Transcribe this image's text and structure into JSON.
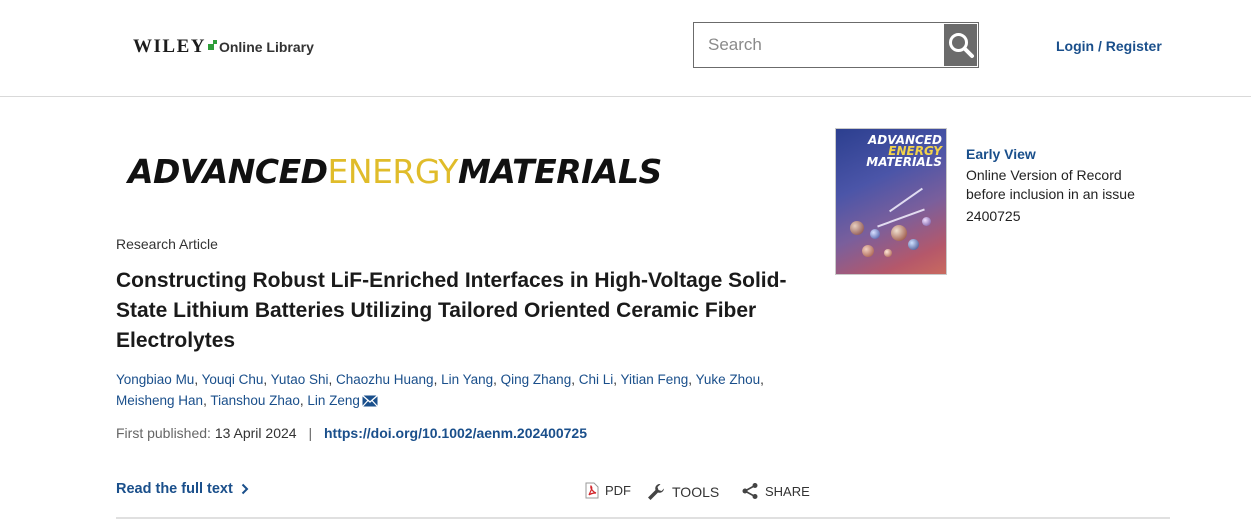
{
  "header": {
    "logo_wiley": "WILEY",
    "logo_online_library": "Online Library",
    "search_placeholder": "Search",
    "login_label": "Login / Register"
  },
  "journal": {
    "word1": "ADVANCED",
    "word2": "ENERGY",
    "word3": "MATERIALS",
    "accent_color": "#e0bc2a"
  },
  "article": {
    "type": "Research Article",
    "title": "Constructing Robust LiF-Enriched Interfaces in High-Voltage Solid-State Lithium Batteries Utilizing Tailored Oriented Ceramic Fiber Electrolytes",
    "authors": [
      "Yongbiao Mu",
      "Youqi Chu",
      "Yutao Shi",
      "Chaozhu Huang",
      "Lin Yang",
      "Qing Zhang",
      "Chi Li",
      "Yitian Feng",
      "Yuke Zhou",
      "Meisheng Han",
      "Tianshou Zhao",
      "Lin Zeng"
    ],
    "corresponding_icon": "envelope-icon",
    "first_published_label": "First published:",
    "first_published_date": "13 April 2024",
    "doi": "https://doi.org/10.1002/aenm.202400725"
  },
  "actions": {
    "read_full_text": "Read the full text",
    "pdf": "PDF",
    "tools": "TOOLS",
    "share": "SHARE"
  },
  "cover": {
    "title_line1": "ADVANCED",
    "title_line2": "ENERGY",
    "title_line3": "MATERIALS"
  },
  "early_view": {
    "title": "Early View",
    "line1": "Online Version of Record",
    "line2": "before inclusion in an issue",
    "article_number": "2400725"
  },
  "colors": {
    "link": "#1a4f8b",
    "search_button": "#6b6b6b",
    "logo_green": "#2e9e3a"
  }
}
